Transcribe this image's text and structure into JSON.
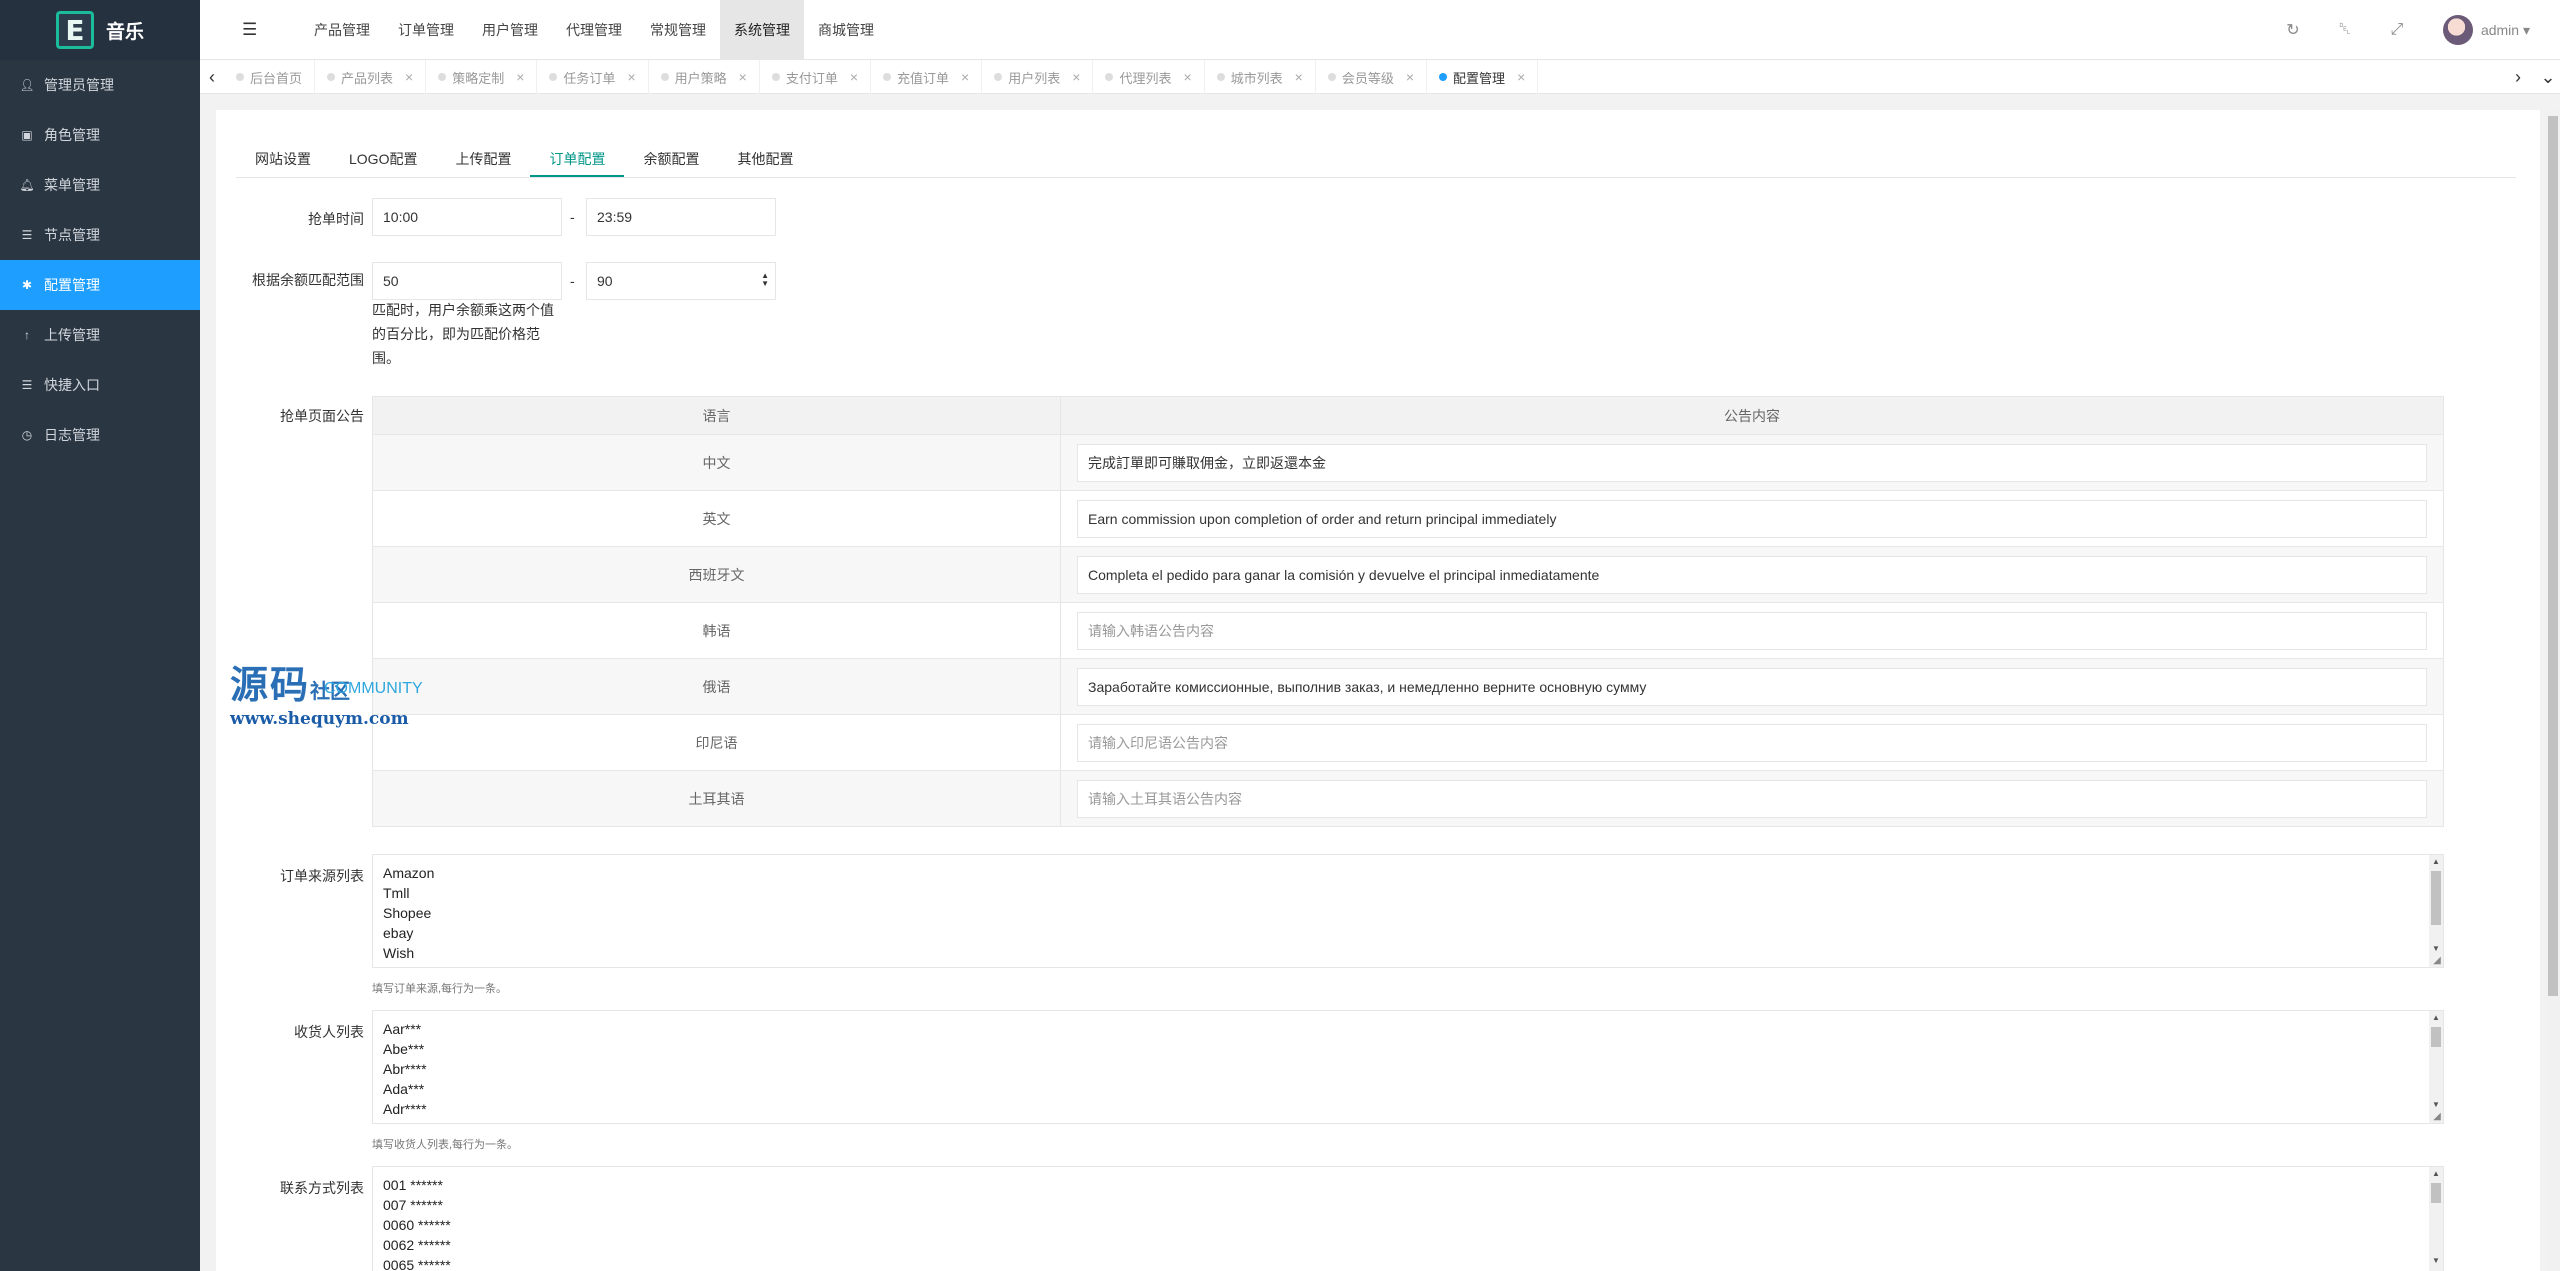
{
  "brand": {
    "logo_letter": "E",
    "name": "音乐"
  },
  "sidebar": {
    "items": [
      {
        "label": "管理员管理",
        "icon": "user-icon"
      },
      {
        "label": "角色管理",
        "icon": "id-card-icon"
      },
      {
        "label": "菜单管理",
        "icon": "bell-icon"
      },
      {
        "label": "节点管理",
        "icon": "list-icon"
      },
      {
        "label": "配置管理",
        "icon": "gear-icon",
        "active": true
      },
      {
        "label": "上传管理",
        "icon": "arrow-up-icon"
      },
      {
        "label": "快捷入口",
        "icon": "list-icon"
      },
      {
        "label": "日志管理",
        "icon": "clock-icon"
      }
    ]
  },
  "topnav": {
    "items": [
      "产品管理",
      "订单管理",
      "用户管理",
      "代理管理",
      "常规管理",
      "系统管理",
      "商城管理"
    ],
    "active": "系统管理"
  },
  "header": {
    "user": "admin"
  },
  "tabs": [
    "后台首页",
    "产品列表",
    "策略定制",
    "任务订单",
    "用户策略",
    "支付订单",
    "充值订单",
    "用户列表",
    "代理列表",
    "城市列表",
    "会员等级",
    "配置管理"
  ],
  "subtabs": [
    "网站设置",
    "LOGO配置",
    "上传配置",
    "订单配置",
    "余额配置",
    "其他配置"
  ],
  "form": {
    "grab_time": {
      "label": "抢单时间",
      "start": "10:00",
      "end": "23:59"
    },
    "balance_range": {
      "label": "根据余额匹配范围",
      "min": "50",
      "max": "90",
      "hint": "匹配时，用户余额乘这两个值的百分比，即为匹配价格范围。"
    },
    "notice": {
      "label": "抢单页面公告",
      "col_lang": "语言",
      "col_content": "公告内容",
      "rows": [
        {
          "lang": "中文",
          "value": "完成訂單即可賺取佣金，立即返還本金",
          "placeholder": ""
        },
        {
          "lang": "英文",
          "value": "Earn commission upon completion of order and return principal immediately",
          "placeholder": ""
        },
        {
          "lang": "西班牙文",
          "value": "Completa el pedido para ganar la comisión y devuelve el principal inmediatamente",
          "placeholder": ""
        },
        {
          "lang": "韩语",
          "value": "",
          "placeholder": "请输入韩语公告内容"
        },
        {
          "lang": "俄语",
          "value": "Заработайте комиссионные, выполнив заказ, и немедленно верните основную сумму",
          "placeholder": ""
        },
        {
          "lang": "印尼语",
          "value": "",
          "placeholder": "请输入印尼语公告内容"
        },
        {
          "lang": "土耳其语",
          "value": "",
          "placeholder": "请输入土耳其语公告内容"
        }
      ]
    },
    "sources": {
      "label": "订单来源列表",
      "lines": [
        "Amazon",
        "Tmll",
        "Shopee",
        "ebay",
        "Wish"
      ],
      "hint": "填写订单来源,每行为一条。"
    },
    "receivers": {
      "label": "收货人列表",
      "lines": [
        "Aar***",
        "Abe***",
        "Abr****",
        "Ada***",
        "Adr****"
      ],
      "hint": "填写收货人列表,每行为一条。"
    },
    "contacts": {
      "label": "联系方式列表",
      "lines": [
        "001 ******",
        "007 ******",
        "0060 ******",
        "0062 ******",
        "0065 ******"
      ]
    }
  },
  "watermark": {
    "big": "源码",
    "small": "社区",
    "community": "COMMUNITY",
    "url": "www.shequym.com"
  }
}
